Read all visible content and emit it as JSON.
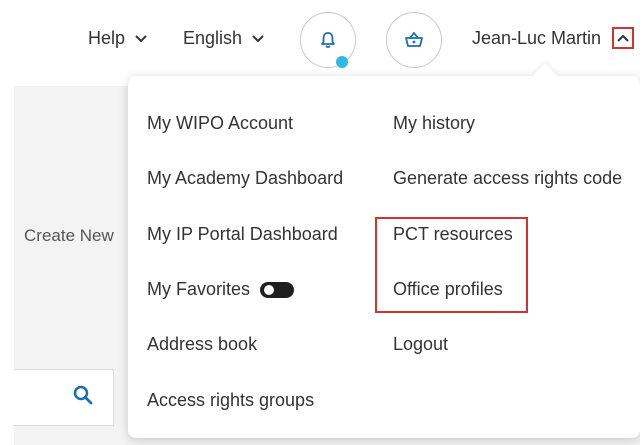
{
  "header": {
    "help_label": "Help",
    "language_label": "English",
    "notifications_icon": "bell-icon",
    "basket_icon": "basket-icon",
    "user_name": "Jean-Luc Martin",
    "notification_dot_color": "#2db8e8",
    "highlight_color": "#d0342c"
  },
  "background": {
    "create_new_label": "Create New",
    "search_icon": "search-icon"
  },
  "dropdown": {
    "left_column": [
      "My WIPO Account",
      "My Academy Dashboard",
      "My IP Portal Dashboard",
      "My Favorites",
      "Address book",
      "Access rights groups"
    ],
    "right_column": [
      "My history",
      "Generate access rights code",
      "PCT resources",
      "Office profiles",
      "Logout"
    ]
  },
  "colors": {
    "accent_blue": "#1a6fb4",
    "text": "#333333"
  }
}
